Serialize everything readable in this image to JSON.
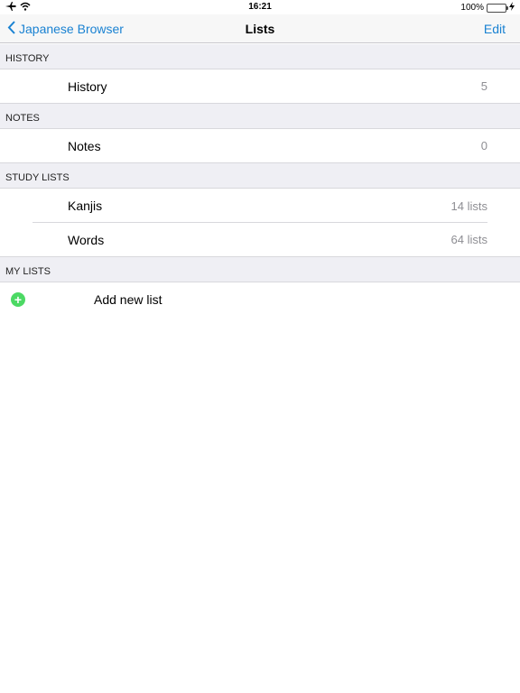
{
  "status": {
    "time": "16:21",
    "battery": "100%",
    "icons": [
      "airplane-icon",
      "wifi-icon",
      "charging-icon"
    ]
  },
  "nav": {
    "back_label": "Japanese Browser",
    "title": "Lists",
    "edit_label": "Edit"
  },
  "sections": {
    "history": {
      "header": "HISTORY",
      "rows": [
        {
          "label": "History",
          "value": "5"
        }
      ]
    },
    "notes": {
      "header": "NOTES",
      "rows": [
        {
          "label": "Notes",
          "value": "0"
        }
      ]
    },
    "study": {
      "header": "STUDY LISTS",
      "rows": [
        {
          "label": "Kanjis",
          "value": "14 lists"
        },
        {
          "label": "Words",
          "value": "64 lists"
        }
      ]
    },
    "mylists": {
      "header": "MY LISTS",
      "add_label": "Add new list"
    }
  },
  "colors": {
    "accent": "#1a82d2",
    "add": "#4cd964",
    "section_bg": "#efeff4"
  }
}
